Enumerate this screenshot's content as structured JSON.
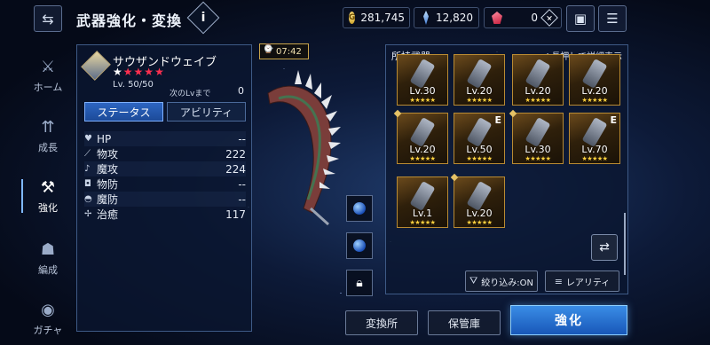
{
  "header": {
    "title": "武器強化・変換",
    "info_label": "i"
  },
  "currencies": {
    "gold": "281,745",
    "gold_symbol": "G",
    "crystal": "12,820",
    "gem": "0"
  },
  "nav": {
    "items": [
      {
        "label": "ホーム"
      },
      {
        "label": "成長"
      },
      {
        "label": "強化"
      },
      {
        "label": "編成"
      },
      {
        "label": "ガチャ"
      }
    ]
  },
  "character": {
    "name": "サウザンドウェイブ",
    "rarity_filled": 1,
    "rarity_total": 5,
    "level": "Lv. 50/50",
    "next_level_label": "次のLvまで",
    "next_level_value": "0",
    "tabs": [
      "ステータス",
      "アビリティ"
    ],
    "stats": [
      {
        "icon": "heart-icon",
        "name": "HP",
        "value": "--"
      },
      {
        "icon": "sword-icon",
        "name": "物攻",
        "value": "222"
      },
      {
        "icon": "wand-icon",
        "name": "魔攻",
        "value": "224"
      },
      {
        "icon": "shield-icon",
        "name": "物防",
        "value": "--"
      },
      {
        "icon": "magic-shield-icon",
        "name": "魔防",
        "value": "--"
      },
      {
        "icon": "cross-icon",
        "name": "治癒",
        "value": "117"
      }
    ]
  },
  "center": {
    "timer": "07:42"
  },
  "weapons": {
    "title": "所持武器",
    "hint": "※長押しで詳細表示",
    "items": [
      {
        "level": "Lv.30",
        "badge": ""
      },
      {
        "level": "Lv.20",
        "badge": ""
      },
      {
        "level": "Lv.20",
        "badge": ""
      },
      {
        "level": "Lv.20",
        "badge": ""
      },
      {
        "level": "Lv.20",
        "badge": ""
      },
      {
        "level": "Lv.50",
        "badge": "E"
      },
      {
        "level": "Lv.30",
        "badge": ""
      },
      {
        "level": "Lv.70",
        "badge": "E"
      },
      {
        "level": "Lv.1",
        "badge": ""
      },
      {
        "level": "Lv.20",
        "badge": ""
      }
    ],
    "stars": "★★★★★",
    "filter_label": "絞り込み:ON",
    "sort_label": "レアリティ"
  },
  "footer": {
    "exchange_label": "変換所",
    "vault_label": "保管庫",
    "enhance_label": "強化"
  },
  "colors": {
    "accent": "#2d66c2",
    "gold_frame": "#b98b33",
    "star_red": "#ff2f4f"
  }
}
